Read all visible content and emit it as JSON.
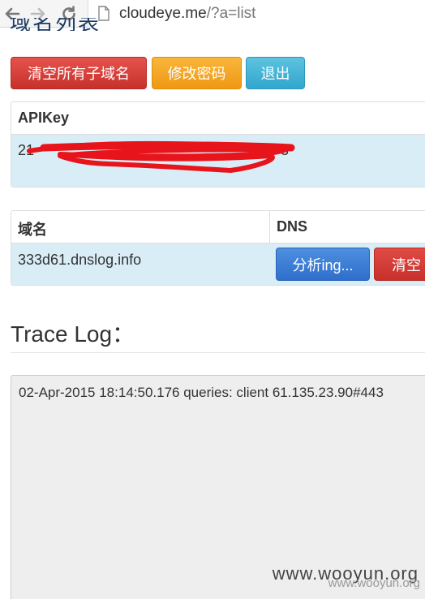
{
  "browser": {
    "url_host": "cloudeye.me",
    "url_path": "/?a=list"
  },
  "page": {
    "cut_title": "域名列表",
    "buttons": {
      "clear_subdomains": "清空所有子域名",
      "change_password": "修改密码",
      "logout": "退出"
    },
    "apikey_table": {
      "header": "APIKey",
      "value_prefix": "21",
      "value_suffix": "3"
    },
    "domain_table": {
      "col_domain": "域名",
      "col_dns": "DNS",
      "rows": [
        {
          "domain": "333d61.dnslog.info",
          "analyze_label": "分析ing...",
          "clear_label": "清空"
        }
      ]
    },
    "trace_title": "Trace Log：",
    "trace_log": {
      "line": "02-Apr-2015 18:14:50.176 queries: client 61.135.23.90#443"
    },
    "watermark": "www.wooyun.org",
    "watermark_small": "www.wooyun.org"
  },
  "colors": {
    "danger": "#d9534f",
    "warning": "#f0ad4e",
    "info": "#5bc0de",
    "primary": "#428bca",
    "row_highlight": "#d9edf7",
    "redaction": "#e8141b"
  }
}
